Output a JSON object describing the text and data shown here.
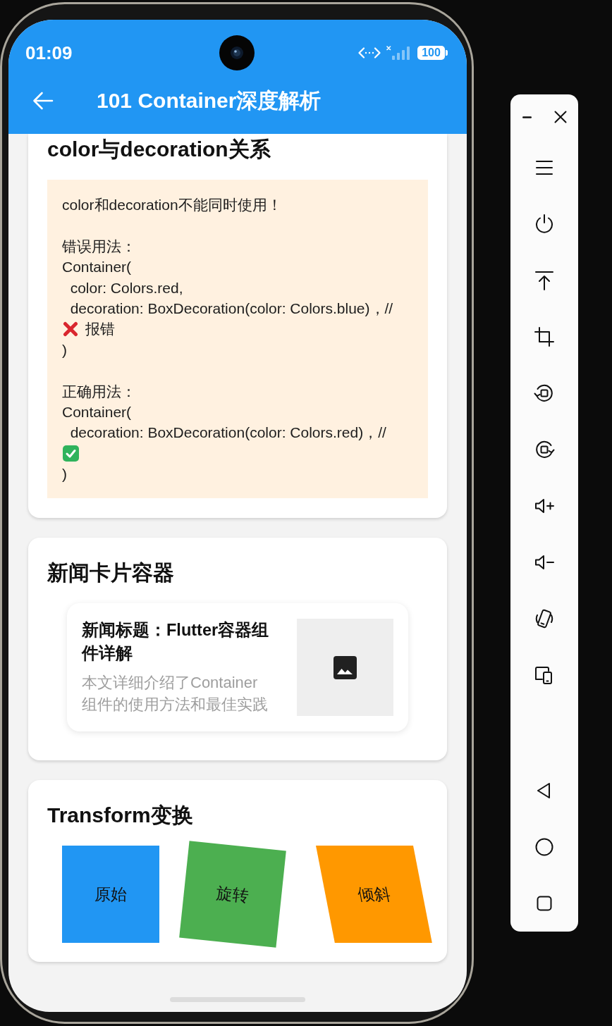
{
  "status_bar": {
    "time": "01:09",
    "battery": "100"
  },
  "app_bar": {
    "title": "101 Container深度解析"
  },
  "sections": [
    {
      "kind": "code",
      "title": "color与decoration关系",
      "lines": [
        {
          "kind": "text",
          "text": "color和decoration不能同时使用！"
        },
        {
          "kind": "blank"
        },
        {
          "kind": "text",
          "text": "错误用法："
        },
        {
          "kind": "text",
          "text": "Container("
        },
        {
          "kind": "text",
          "text": "  color: Colors.red,"
        },
        {
          "kind": "text",
          "text": "  decoration: BoxDecoration(color: Colors.blue)，//"
        },
        {
          "kind": "error",
          "text": "报错"
        },
        {
          "kind": "text",
          "text": ")"
        },
        {
          "kind": "blank"
        },
        {
          "kind": "text",
          "text": "正确用法："
        },
        {
          "kind": "text",
          "text": "Container("
        },
        {
          "kind": "text",
          "text": "  decoration: BoxDecoration(color: Colors.red)，//"
        },
        {
          "kind": "ok"
        },
        {
          "kind": "text",
          "text": ")"
        }
      ]
    },
    {
      "kind": "news",
      "title": "新闻卡片容器",
      "news": {
        "title": "新闻标题：Flutter容器组件详解",
        "summary": "本文详细介绍了Container组件的使用方法和最佳实践"
      }
    },
    {
      "kind": "transform",
      "title": "Transform变换",
      "boxes": [
        {
          "kind": "original",
          "label": "原始",
          "color": "#2196f3"
        },
        {
          "kind": "rotate",
          "label": "旋转",
          "color": "#4caf50"
        },
        {
          "kind": "skew",
          "label": "倾斜",
          "color": "#ff9800"
        }
      ]
    }
  ]
}
